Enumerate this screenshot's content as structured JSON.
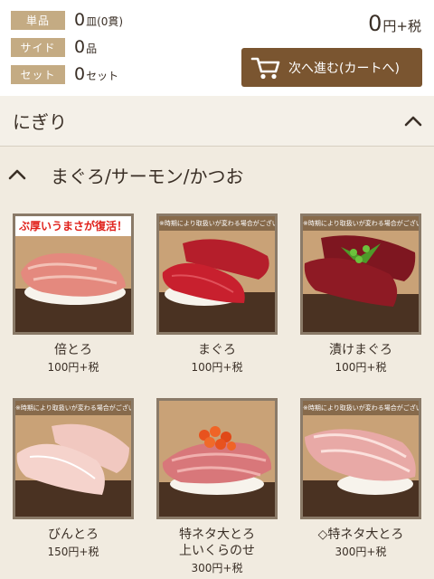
{
  "summary": {
    "rows": [
      {
        "label": "単品",
        "value": "0",
        "unit": "皿(0貫)"
      },
      {
        "label": "サイド",
        "value": "0",
        "unit": "品"
      },
      {
        "label": "セット",
        "value": "0",
        "unit": "セット"
      }
    ],
    "total_value": "0",
    "total_unit": "円+税",
    "next_button_label": "次へ進む(カートへ)"
  },
  "category": {
    "title": "にぎり"
  },
  "subcategory": {
    "title": "まぐろ/サーモン/かつお"
  },
  "items": [
    {
      "name": "倍とろ",
      "price": "100円+税",
      "banner": "ぶ厚いうまさが復活！"
    },
    {
      "name": "まぐろ",
      "price": "100円+税",
      "banner": "※時期により取扱いが変わる場合がございます"
    },
    {
      "name": "漬けまぐろ",
      "price": "100円+税",
      "banner": "※時期により取扱いが変わる場合がございます"
    },
    {
      "name": "びんとろ",
      "price": "150円+税",
      "banner": "※時期により取扱いが変わる場合がございます"
    },
    {
      "name": "特ネタ大とろ\n上いくらのせ",
      "price": "300円+税",
      "banner": ""
    },
    {
      "name": "◇特ネタ大とろ",
      "price": "300円+税",
      "banner": "※時期により取扱いが変わる場合がございます"
    }
  ],
  "colors": {
    "accent": "#7a5530",
    "label_bg": "#c4ab83",
    "background": "#f1ebe0"
  },
  "icons": {
    "cart": "cart-icon",
    "collapse": "chevron-up-icon"
  }
}
